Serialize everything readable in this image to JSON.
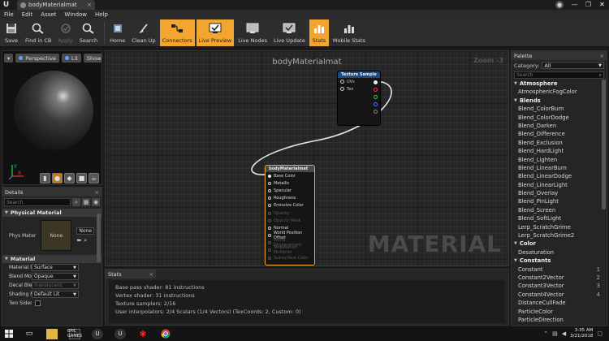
{
  "window": {
    "tab_title": "bodyMaterialmat",
    "tab_close": "×",
    "minimize": "—",
    "restore": "❐",
    "close": "✕"
  },
  "menu": [
    "File",
    "Edit",
    "Asset",
    "Window",
    "Help"
  ],
  "toolbar": {
    "save": "Save",
    "find_in_cb": "Find in CB",
    "apply": "Apply",
    "search": "Search",
    "home": "Home",
    "clean_up": "Clean Up",
    "connectors": "Connectors",
    "live_preview": "Live Preview",
    "live_nodes": "Live Nodes",
    "live_update": "Live Update",
    "stats": "Stats",
    "mobile_stats": "Mobile Stats"
  },
  "viewport": {
    "perspective": "Perspective",
    "lit": "Lit",
    "show": "Show",
    "axis_x": "X",
    "axis_y": "Y"
  },
  "details": {
    "tab": "Details",
    "search_placeholder": "Search",
    "physical_section": "Physical Material",
    "phys_label": "Phys Mater",
    "thumb_label": "None",
    "none_dropdown": "None",
    "material_section": "Material",
    "rows": [
      {
        "name": "Material Do",
        "value": "Surface"
      },
      {
        "name": "Blend Mode",
        "value": "Opaque"
      },
      {
        "name": "Decal Blend",
        "value": "Translucent"
      },
      {
        "name": "Shading Mo",
        "value": "Default Lit"
      }
    ],
    "two_sided": "Two Sided"
  },
  "graph": {
    "title": "bodyMaterialmat",
    "zoom": "Zoom -3",
    "watermark": "MATERIAL",
    "texture_node": {
      "title": "Texture Sample",
      "inputs": [
        "UVs",
        "Tex"
      ]
    },
    "material_node": {
      "title": "bodyMaterialmat",
      "pins": [
        {
          "label": "Base Color",
          "active": true
        },
        {
          "label": "Metallic",
          "active": true
        },
        {
          "label": "Specular",
          "active": true
        },
        {
          "label": "Roughness",
          "active": true
        },
        {
          "label": "Emissive Color",
          "active": true
        },
        {
          "label": "Opacity",
          "active": false
        },
        {
          "label": "Opacity Mask",
          "active": false
        },
        {
          "label": "Normal",
          "active": true
        },
        {
          "label": "World Position Offset",
          "active": true
        },
        {
          "label": "World Displacement",
          "active": false
        },
        {
          "label": "Tessellation Multiplier",
          "active": false
        },
        {
          "label": "Subsurface Color",
          "active": false
        }
      ]
    }
  },
  "stats": {
    "tab": "Stats",
    "lines": [
      "Base pass shader: 81 instructions",
      "Vertex shader: 31 instructions",
      "Texture samplers: 2/16",
      "User interpolators: 2/4 Scalars (1/4 Vectors) (TexCoords: 2, Custom: 0)"
    ]
  },
  "palette": {
    "tab": "Palette",
    "category_label": "Category:",
    "category_value": "All",
    "search_placeholder": "Search",
    "items": [
      {
        "type": "cat",
        "label": "Atmosphere"
      },
      {
        "type": "item",
        "label": "AtmosphericFogColor"
      },
      {
        "type": "cat",
        "label": "Blends"
      },
      {
        "type": "item",
        "label": "Blend_ColorBurn"
      },
      {
        "type": "item",
        "label": "Blend_ColorDodge"
      },
      {
        "type": "item",
        "label": "Blend_Darken"
      },
      {
        "type": "item",
        "label": "Blend_Difference"
      },
      {
        "type": "item",
        "label": "Blend_Exclusion"
      },
      {
        "type": "item",
        "label": "Blend_HardLight"
      },
      {
        "type": "item",
        "label": "Blend_Lighten"
      },
      {
        "type": "item",
        "label": "Blend_LinearBurn"
      },
      {
        "type": "item",
        "label": "Blend_LinearDodge"
      },
      {
        "type": "item",
        "label": "Blend_LinearLight"
      },
      {
        "type": "item",
        "label": "Blend_Overlay"
      },
      {
        "type": "item",
        "label": "Blend_PinLight"
      },
      {
        "type": "item",
        "label": "Blend_Screen"
      },
      {
        "type": "item",
        "label": "Blend_SoftLight"
      },
      {
        "type": "item",
        "label": "Lerp_ScratchGrime"
      },
      {
        "type": "item",
        "label": "Lerp_ScratchGrime2"
      },
      {
        "type": "cat",
        "label": "Color"
      },
      {
        "type": "item",
        "label": "Desaturation"
      },
      {
        "type": "cat",
        "label": "Constants"
      },
      {
        "type": "item",
        "label": "Constant",
        "hotkey": "1"
      },
      {
        "type": "item",
        "label": "Constant2Vector",
        "hotkey": "2"
      },
      {
        "type": "item",
        "label": "Constant3Vector",
        "hotkey": "3"
      },
      {
        "type": "item",
        "label": "Constant4Vector",
        "hotkey": "4"
      },
      {
        "type": "item",
        "label": "DistanceCullFade"
      },
      {
        "type": "item",
        "label": "ParticleColor"
      },
      {
        "type": "item",
        "label": "ParticleDirection"
      }
    ]
  },
  "taskbar": {
    "epic_label": "EPIC GAMES",
    "time": "3:35 AM",
    "date": "3/21/2018"
  },
  "colors": {
    "accent": "#f2a531",
    "texture_header": "#1d4b80"
  }
}
